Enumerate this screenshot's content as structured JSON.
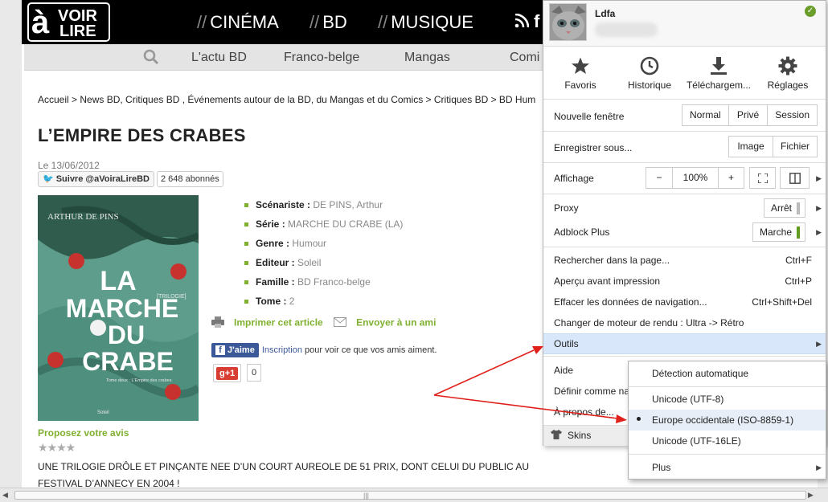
{
  "site": {
    "logo": {
      "a": "à",
      "voir": "VOIR",
      "lire": "LIRE"
    },
    "top_nav": [
      {
        "label": "CINÉMA"
      },
      {
        "label": "BD"
      },
      {
        "label": "MUSIQUE"
      }
    ],
    "nav_sep": "//",
    "top_social": {
      "facebook": "f"
    },
    "sub_nav": [
      "L'actu BD",
      "Franco-belge",
      "Mangas",
      "Comi"
    ],
    "breadcrumb": "Accueil > News BD, Critiques BD , Événements autour de la BD, du Mangas et du Comics > Critiques BD > BD Hum",
    "title": "L’EMPIRE DES CRABES",
    "date": "Le 13/06/2012",
    "twitter": {
      "follow": "Suivre @aVoiraLireBD",
      "count": "2 648 abonnés"
    },
    "cover": {
      "author": "ARTHUR DE PINS",
      "title_lines": [
        "LA",
        "MARCHE",
        "DU",
        "CRABE"
      ],
      "subtitle": "[TRILOGIE]",
      "volume": "Tome deux : L'Empire des crabes",
      "publisher": "Soleil"
    },
    "properties": [
      {
        "key": "Scénariste :",
        "value": "DE PINS, Arthur"
      },
      {
        "key": "Série :",
        "value": "MARCHE DU CRABE (LA)"
      },
      {
        "key": "Genre :",
        "value": "Humour"
      },
      {
        "key": "Editeur :",
        "value": "Soleil"
      },
      {
        "key": "Famille :",
        "value": "BD Franco-belge"
      },
      {
        "key": "Tome :",
        "value": "2"
      }
    ],
    "print_label": "Imprimer cet article",
    "send_label": "Envoyer à un ami",
    "fb_like": {
      "button": "J'aime",
      "link": "Inscription",
      "text": " pour voir ce que vos amis aiment."
    },
    "gplus": {
      "button": "g+1",
      "count": "0"
    },
    "review_label": "Proposez votre avis",
    "stars": "★★★★",
    "summary": "UNE TRILOGIE DRÔLE ET PINÇANTE NEE D’UN COURT AUREOLE DE 51 PRIX, DONT CELUI DU PUBLIC AU FESTIVAL D’ANNECY EN 2004 !"
  },
  "menu": {
    "user": {
      "name": "Ldfa"
    },
    "quick_actions": [
      {
        "label": "Favoris",
        "icon": "star-icon"
      },
      {
        "label": "Historique",
        "icon": "clock-icon"
      },
      {
        "label": "Téléchargem...",
        "icon": "download-icon"
      },
      {
        "label": "Réglages",
        "icon": "gear-icon"
      }
    ],
    "new_window": {
      "label": "Nouvelle fenêtre",
      "options": [
        "Normal",
        "Privé",
        "Session"
      ]
    },
    "save_as": {
      "label": "Enregistrer sous...",
      "options": [
        "Image",
        "Fichier"
      ]
    },
    "display": {
      "label": "Affichage",
      "minus": "−",
      "zoom": "100%",
      "plus": "+"
    },
    "proxy": {
      "label": "Proxy",
      "state": "Arrêt"
    },
    "adblock": {
      "label": "Adblock Plus",
      "state": "Marche"
    },
    "items": [
      {
        "label": "Rechercher dans la page...",
        "shortcut": "Ctrl+F"
      },
      {
        "label": "Aperçu avant impression",
        "shortcut": "Ctrl+P"
      },
      {
        "label": "Effacer les données de navigation...",
        "shortcut": "Ctrl+Shift+Del"
      },
      {
        "label": "Changer de moteur de rendu : Ultra -> Rétro",
        "shortcut": ""
      }
    ],
    "tools": "Outils",
    "help": "Aide",
    "default": "Définir comme na",
    "about": "À propos de...",
    "skins": "Skins"
  },
  "submenu": {
    "items": [
      {
        "label": "Détection automatique",
        "selected": false
      },
      {
        "label": "Unicode (UTF-8)",
        "selected": false
      },
      {
        "label": "Europe occidentale (ISO-8859-1)",
        "selected": true
      },
      {
        "label": "Unicode (UTF-16LE)",
        "selected": false
      },
      {
        "label": "Plus",
        "selected": false
      }
    ]
  },
  "colors": {
    "accent_green": "#7fb030",
    "annotation_red": "#e0201b",
    "highlight": "#d8e8fa"
  }
}
